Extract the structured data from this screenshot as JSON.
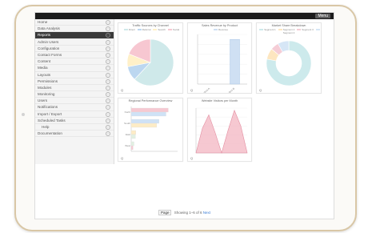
{
  "topbar": {
    "menu_label": "Menu"
  },
  "sidebar": {
    "items": [
      {
        "label": "Home"
      },
      {
        "label": "Data Analysis"
      },
      {
        "label": "Reports"
      },
      {
        "label": "Admin Users"
      },
      {
        "label": "Configuration"
      },
      {
        "label": "Contact Forms"
      },
      {
        "label": "Content"
      },
      {
        "label": "Media"
      },
      {
        "label": "Layouts"
      },
      {
        "label": "Permissions"
      },
      {
        "label": "Modules"
      },
      {
        "label": "Monitoring"
      },
      {
        "label": "Users"
      },
      {
        "label": "Notifications"
      },
      {
        "label": "Import / Export"
      },
      {
        "label": "Scheduled Tasks"
      },
      {
        "label": "Help"
      },
      {
        "label": "Documentation"
      }
    ]
  },
  "pager": {
    "button": "Page",
    "text": "Showing 1–6 of 6",
    "link": "Next"
  },
  "chart_data": [
    {
      "type": "pie",
      "title": "Traffic Sources by Channel",
      "legend": [
        "Direct",
        "Referral",
        "Search",
        "Social"
      ],
      "values": [
        62,
        10,
        9,
        19
      ],
      "colors": [
        "#cfe9ea",
        "#bcd7f0",
        "#fff0c8",
        "#f7c7d1"
      ],
      "footer": "Q"
    },
    {
      "type": "bar",
      "title": "Sales Revenue by Product",
      "legend": [
        "Revenue"
      ],
      "categories": [
        "Product A",
        "Product B"
      ],
      "values": [
        0,
        90
      ],
      "ylim": [
        0,
        100
      ],
      "colors": [
        "#cfe0f3"
      ],
      "footer": "Q"
    },
    {
      "type": "pie",
      "title": "Market Share Breakdown",
      "legend": [
        "Segment 1",
        "Segment 2",
        "Segment 3",
        "Segment 4"
      ],
      "values": [
        78,
        8,
        6,
        8
      ],
      "colors": [
        "#cdeaec",
        "#fde6c0",
        "#f5cdd6",
        "#d6e6f6"
      ],
      "footer": "Q"
    },
    {
      "type": "bar",
      "title": "Regional Performance Overview",
      "legend": [
        "Target",
        "Actual"
      ],
      "categories": [
        "North",
        "South",
        "East",
        "West"
      ],
      "series": [
        {
          "name": "Target",
          "values": [
            80,
            60,
            10,
            6
          ]
        },
        {
          "name": "Actual",
          "values": [
            75,
            55,
            9,
            4
          ]
        }
      ],
      "colors": [
        "#f6c9d2",
        "#cfe2f6",
        "#fdecc6",
        "#e2f0e2"
      ],
      "footer": "Q"
    },
    {
      "type": "area",
      "title": "Website Visitors per Month",
      "legend": [
        "Visitors"
      ],
      "x": [
        0,
        1,
        2,
        3,
        4,
        5,
        6,
        7,
        8
      ],
      "values": [
        0,
        55,
        85,
        45,
        0,
        50,
        95,
        60,
        0
      ],
      "ylim": [
        0,
        100
      ],
      "colors": [
        "#f3b6c2"
      ],
      "footer": "Q"
    }
  ]
}
